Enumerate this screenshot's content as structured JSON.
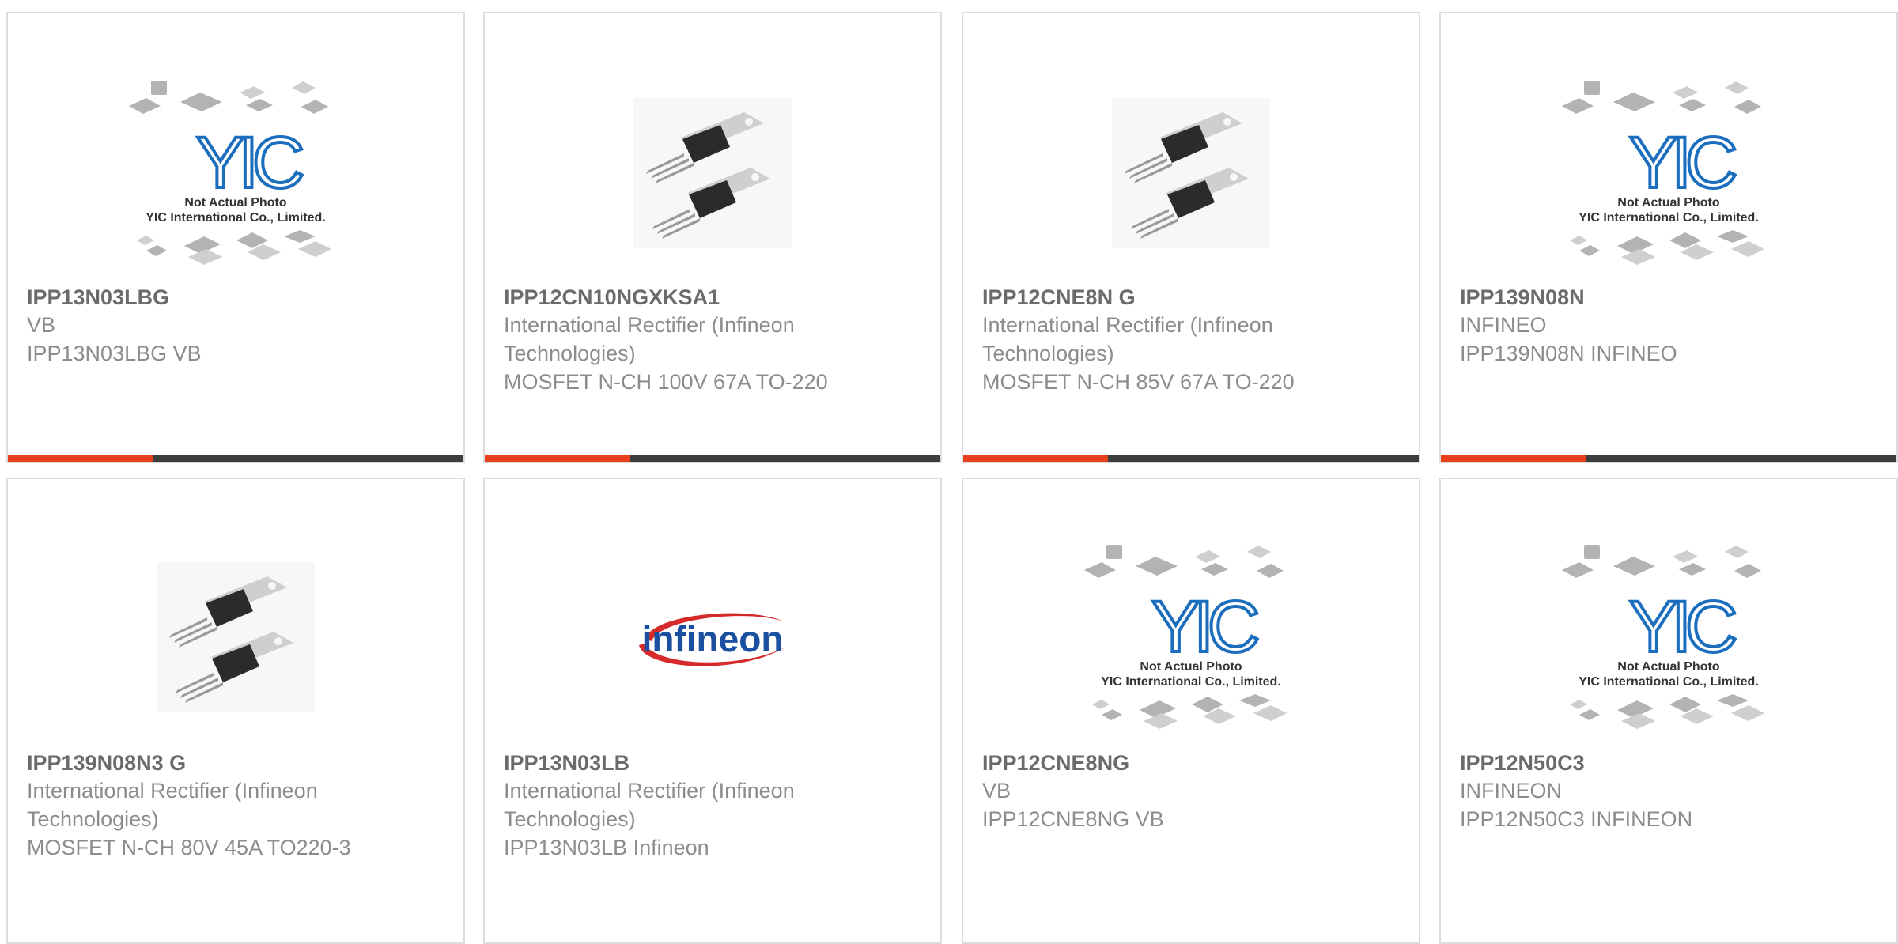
{
  "colors": {
    "accent": "#e8401c",
    "bar": "#3d3d3d",
    "yic_blue": "#1b6ebd",
    "infineon_blue": "#1b4fa0",
    "infineon_red": "#d62a2a"
  },
  "placeholder": {
    "brand": "YIC",
    "line1": "Not Actual Photo",
    "line2": "YIC International Co., Limited."
  },
  "infineon_logo": "infineon",
  "products": [
    {
      "part": "IPP13N03LBG",
      "mfr": "VB",
      "desc": "IPP13N03LBG VB",
      "image": "placeholder"
    },
    {
      "part": "IPP12CN10NGXKSA1",
      "mfr": "International Rectifier (Infineon Technologies)",
      "desc": "MOSFET N-CH 100V 67A TO-220",
      "image": "to220"
    },
    {
      "part": "IPP12CNE8N G",
      "mfr": "International Rectifier (Infineon Technologies)",
      "desc": "MOSFET N-CH 85V 67A TO-220",
      "image": "to220"
    },
    {
      "part": "IPP139N08N",
      "mfr": "INFINEO",
      "desc": "IPP139N08N INFINEO",
      "image": "placeholder"
    },
    {
      "part": "IPP139N08N3 G",
      "mfr": "International Rectifier (Infineon Technologies)",
      "desc": "MOSFET N-CH 80V 45A TO220-3",
      "image": "to220"
    },
    {
      "part": "IPP13N03LB",
      "mfr": "International Rectifier (Infineon Technologies)",
      "desc": "IPP13N03LB Infineon",
      "image": "infineon"
    },
    {
      "part": "IPP12CNE8NG",
      "mfr": "VB",
      "desc": "IPP12CNE8NG VB",
      "image": "placeholder"
    },
    {
      "part": "IPP12N50C3",
      "mfr": "INFINEON",
      "desc": "IPP12N50C3 INFINEON",
      "image": "placeholder"
    }
  ]
}
